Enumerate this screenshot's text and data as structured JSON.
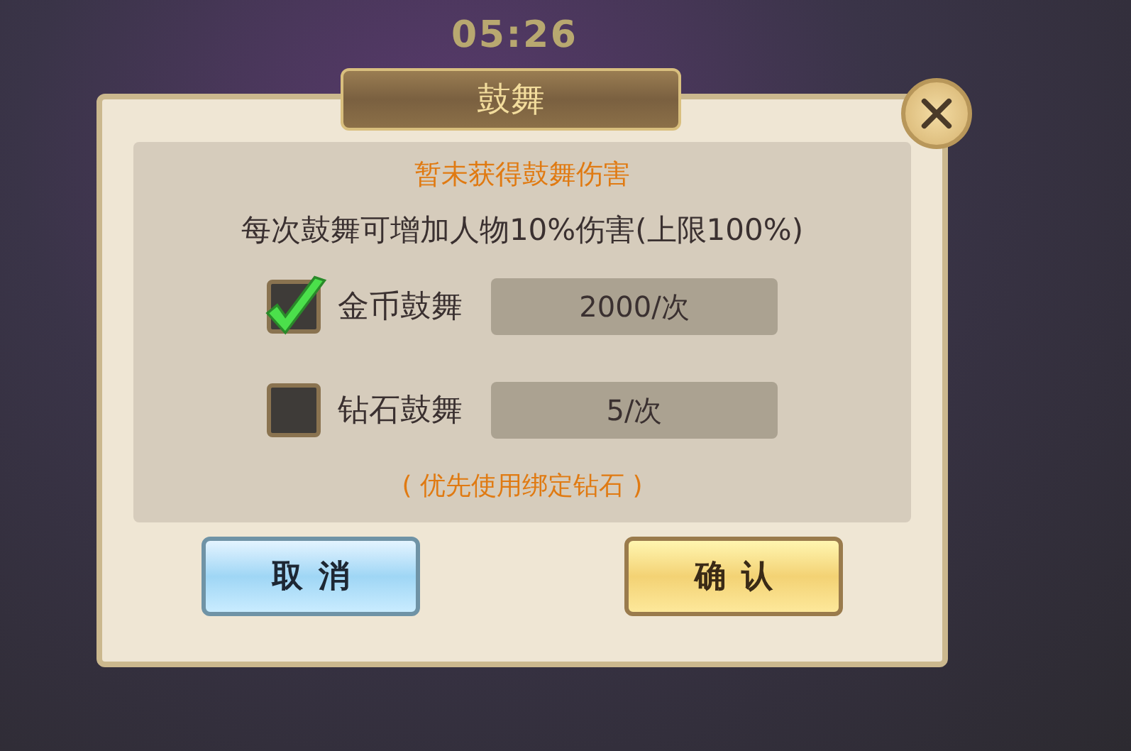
{
  "timer": "05:26",
  "dialog": {
    "title": "鼓舞",
    "status": "暂未获得鼓舞伤害",
    "description": "每次鼓舞可增加人物10%伤害(上限100%)",
    "options": [
      {
        "label": "金币鼓舞",
        "cost": "2000/次",
        "checked": true
      },
      {
        "label": "钻石鼓舞",
        "cost": "5/次",
        "checked": false
      }
    ],
    "note": "( 优先使用绑定钻石 )",
    "buttons": [
      {
        "label": "取消",
        "kind": "cancel"
      },
      {
        "label": "确认",
        "kind": "confirm"
      }
    ]
  }
}
